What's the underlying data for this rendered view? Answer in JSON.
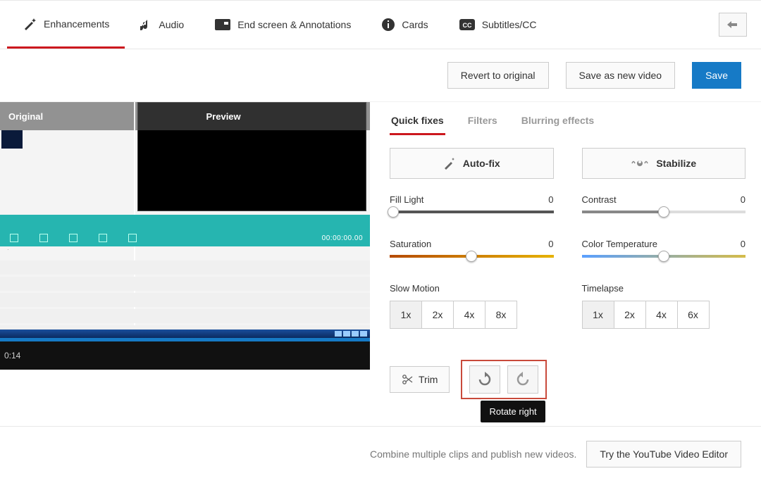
{
  "tabs": {
    "enhancements": "Enhancements",
    "audio": "Audio",
    "endscreen": "End screen & Annotations",
    "cards": "Cards",
    "subtitles": "Subtitles/CC"
  },
  "actions": {
    "revert": "Revert to original",
    "save_as": "Save as new video",
    "save": "Save"
  },
  "preview": {
    "original": "Original",
    "preview": "Preview",
    "timecode": "00:00:00.00",
    "elapsed": "0:14"
  },
  "subtabs": {
    "quick": "Quick fixes",
    "filters": "Filters",
    "blurring": "Blurring effects"
  },
  "controls": {
    "autofix": "Auto-fix",
    "stabilize": "Stabilize",
    "fill_light": {
      "label": "Fill Light",
      "value": "0"
    },
    "contrast": {
      "label": "Contrast",
      "value": "0"
    },
    "saturation": {
      "label": "Saturation",
      "value": "0"
    },
    "color_temp": {
      "label": "Color Temperature",
      "value": "0"
    },
    "slow_motion": {
      "label": "Slow Motion",
      "opts": [
        "1x",
        "2x",
        "4x",
        "8x"
      ]
    },
    "timelapse": {
      "label": "Timelapse",
      "opts": [
        "1x",
        "2x",
        "4x",
        "6x"
      ]
    },
    "trim": "Trim",
    "tooltip": "Rotate right"
  },
  "footer": {
    "text": "Combine multiple clips and publish new videos.",
    "button": "Try the YouTube Video Editor"
  }
}
